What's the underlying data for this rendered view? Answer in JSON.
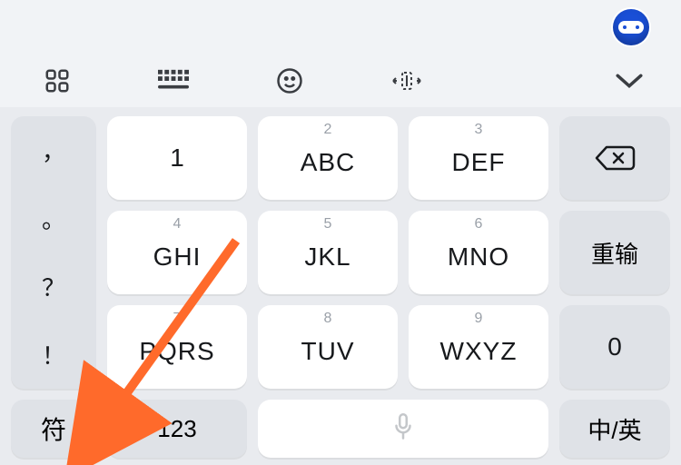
{
  "keys": {
    "k1": {
      "super": "",
      "main": "1"
    },
    "k2": {
      "super": "2",
      "main": "ABC"
    },
    "k3": {
      "super": "3",
      "main": "DEF"
    },
    "k4": {
      "super": "4",
      "main": "GHI"
    },
    "k5": {
      "super": "5",
      "main": "JKL"
    },
    "k6": {
      "super": "6",
      "main": "MNO"
    },
    "k7": {
      "super": "7",
      "main": "PQRS"
    },
    "k8": {
      "super": "8",
      "main": "TUV"
    },
    "k9": {
      "super": "9",
      "main": "WXYZ"
    }
  },
  "punct": {
    "p1": "，",
    "p2": "。",
    "p3": "？",
    "p4": "！"
  },
  "side": {
    "retry": "重输",
    "zero": "0"
  },
  "bottom": {
    "symbols": "符",
    "numbers": "123",
    "lang": "中/英"
  }
}
